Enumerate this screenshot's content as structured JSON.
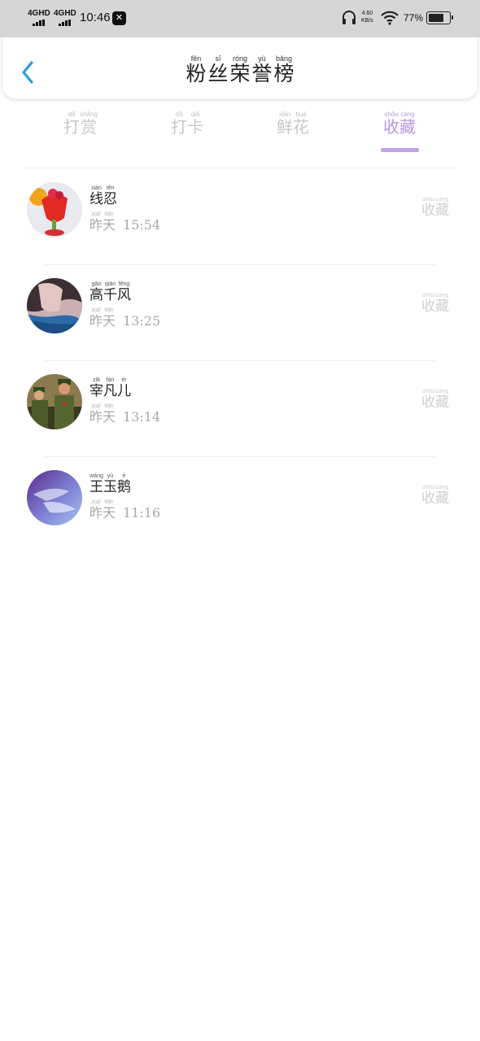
{
  "status_bar": {
    "net1": "4GHD",
    "net2": "4GHD",
    "time": "10:46",
    "speed_value": "4.60",
    "speed_unit": "KB/s",
    "battery_pct": "77%",
    "battery_level": 0.77
  },
  "header": {
    "title": [
      {
        "char": "粉",
        "py": "fěn"
      },
      {
        "char": "丝",
        "py": "sī"
      },
      {
        "char": "荣",
        "py": "róng"
      },
      {
        "char": "誉",
        "py": "yù"
      },
      {
        "char": "榜",
        "py": "bǎng"
      }
    ]
  },
  "tabs": [
    {
      "chars": [
        {
          "char": "打",
          "py": "dǎ"
        },
        {
          "char": "赏",
          "py": "shǎng"
        }
      ]
    },
    {
      "chars": [
        {
          "char": "打",
          "py": "dǎ"
        },
        {
          "char": "卡",
          "py": "qiǎ"
        }
      ]
    },
    {
      "chars": [
        {
          "char": "鲜",
          "py": "xiān"
        },
        {
          "char": "花",
          "py": "huā"
        }
      ]
    },
    {
      "chars": [
        {
          "char": "收",
          "py": "shōu"
        },
        {
          "char": "藏",
          "py": "cáng"
        }
      ]
    }
  ],
  "active_tab": 3,
  "list": {
    "day": [
      {
        "char": "昨",
        "py": "zuó"
      },
      {
        "char": "天",
        "py": "tiān"
      }
    ],
    "action": [
      {
        "char": "收",
        "py": "shōu"
      },
      {
        "char": "藏",
        "py": "cáng"
      }
    ],
    "items": [
      {
        "name": [
          {
            "char": "线",
            "py": "xiàn"
          },
          {
            "char": "忍",
            "py": "rěn"
          }
        ],
        "time": "15:54"
      },
      {
        "name": [
          {
            "char": "高",
            "py": "gāo"
          },
          {
            "char": "千",
            "py": "qiān"
          },
          {
            "char": "风",
            "py": "fēng"
          }
        ],
        "time": "13:25"
      },
      {
        "name": [
          {
            "char": "宰",
            "py": "zǎi"
          },
          {
            "char": "凡",
            "py": "fán"
          },
          {
            "char": "儿",
            "py": "ér"
          }
        ],
        "time": "13:14"
      },
      {
        "name": [
          {
            "char": "王",
            "py": "wáng"
          },
          {
            "char": "玉",
            "py": "yù"
          },
          {
            "char": "鹅",
            "py": "é"
          }
        ],
        "time": "11:16"
      }
    ]
  }
}
